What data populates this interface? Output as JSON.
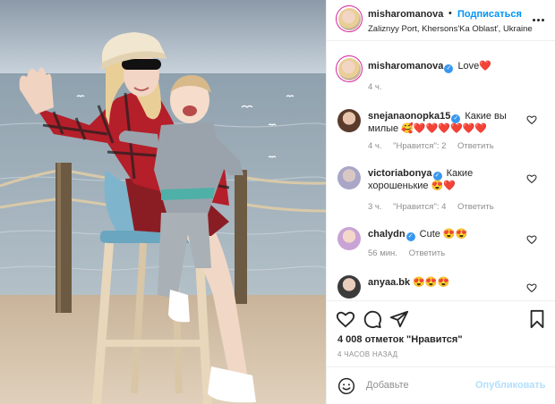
{
  "header": {
    "username": "misharomanova",
    "dot": "•",
    "follow_label": "Подписаться",
    "location": "Zaliznyy Port, Khersons'Ka Oblast', Ukraine"
  },
  "caption": {
    "username": "misharomanova",
    "text": "Love❤️",
    "time": "4 ч."
  },
  "comments": [
    {
      "username": "snejanaonopka15",
      "verified": true,
      "text": "Какие вы милые 🥰❤️❤️❤️❤️❤️❤️",
      "time": "4 ч.",
      "likes": "\"Нравится\": 2",
      "reply": "Ответить"
    },
    {
      "username": "victoriabonya",
      "verified": true,
      "text": "Какие хорошенькие 😍❤️",
      "time": "3 ч.",
      "likes": "\"Нравится\": 4",
      "reply": "Ответить"
    },
    {
      "username": "chalydn",
      "verified": true,
      "text": "Cute 😍😍",
      "time": "56 мин.",
      "likes": "",
      "reply": "Ответить"
    },
    {
      "username": "anyaa.bk",
      "verified": false,
      "text": "😍😍😍",
      "time": "",
      "likes": "",
      "reply": ""
    }
  ],
  "footer": {
    "likes_count": "4 008 отметок \"Нравится\"",
    "posted_time": "4 ЧАСОВ НАЗАД",
    "add_placeholder": "Добавьте",
    "publish_label": "Опубликовать"
  },
  "icons": {
    "like": "heart-outline-icon",
    "comment": "speech-bubble-icon",
    "share": "paper-plane-icon",
    "save": "bookmark-icon",
    "emoji": "smiley-icon",
    "more": "ellipsis-icon"
  },
  "colors": {
    "accent_blue": "#0095f6",
    "verified_blue": "#3897f0",
    "muted_text": "#8e8e8e",
    "divider": "#efefef",
    "publish_disabled": "#b2dffc"
  }
}
